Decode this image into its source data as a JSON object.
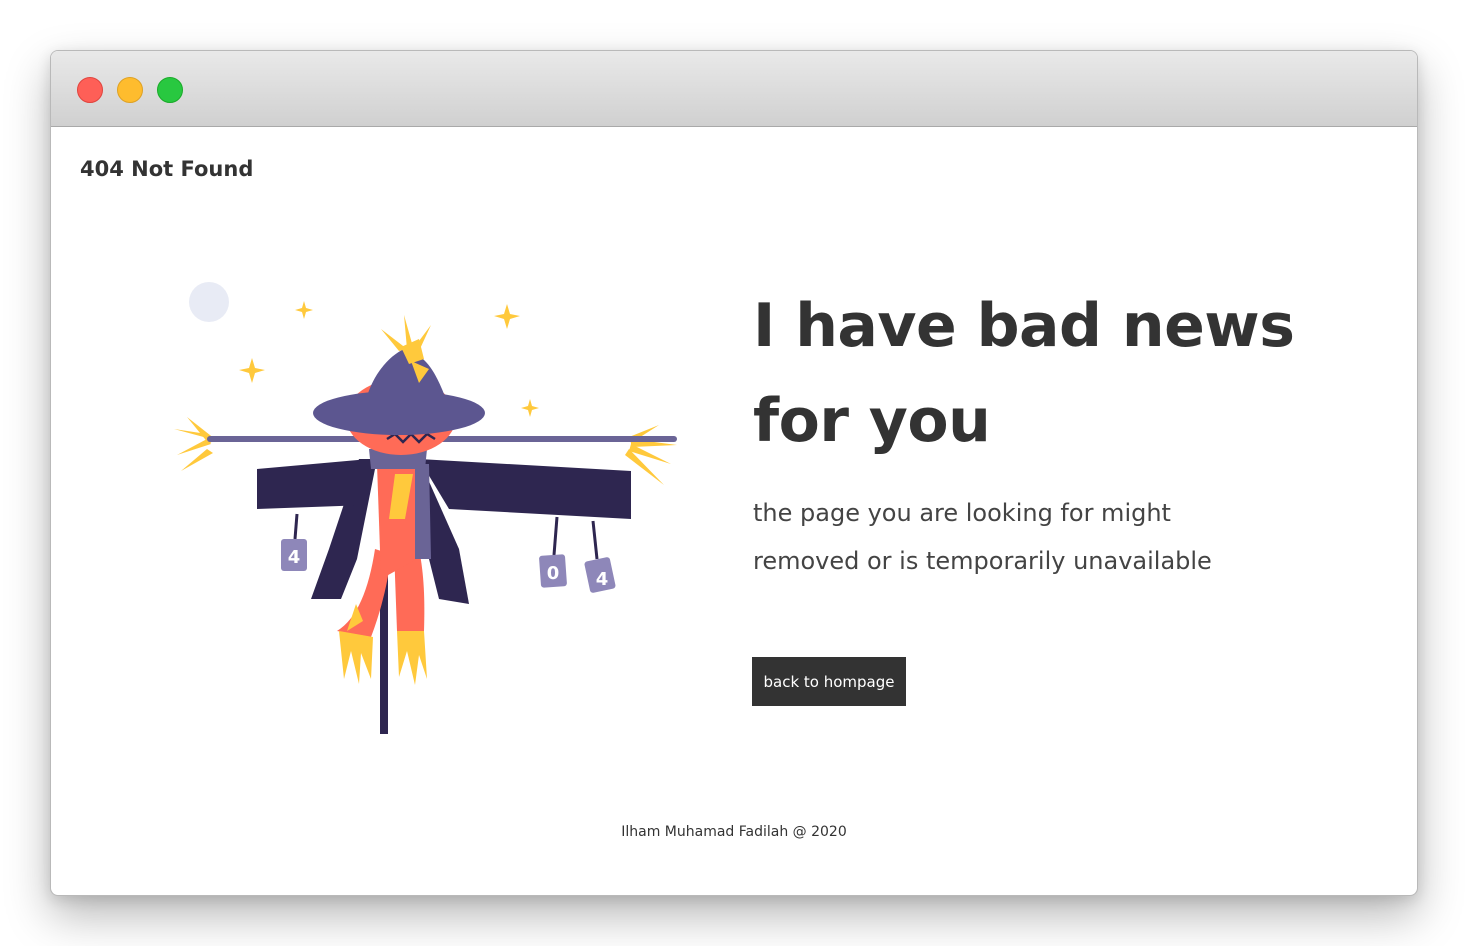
{
  "window": {
    "controls": [
      "close",
      "minimize",
      "maximize"
    ]
  },
  "brand": "404 Not Found",
  "headline": "I have bad news for you",
  "subtext": "the page you are looking for might removed or is temporarily unavailable",
  "button": {
    "label": "back to hompage"
  },
  "illustration": {
    "subject": "scarecrow-illustration",
    "can_labels": [
      "4",
      "0",
      "4"
    ]
  },
  "footer": "Ilham Muhamad Fadilah @ 2020",
  "colors": {
    "text": "#333333",
    "button_bg": "#333333",
    "button_text": "#ffffff",
    "hat": "#5c5690",
    "coat": "#2e2650",
    "face": "#ff6b57",
    "straw": "#ffc93c",
    "moon": "#e8ebf5"
  }
}
